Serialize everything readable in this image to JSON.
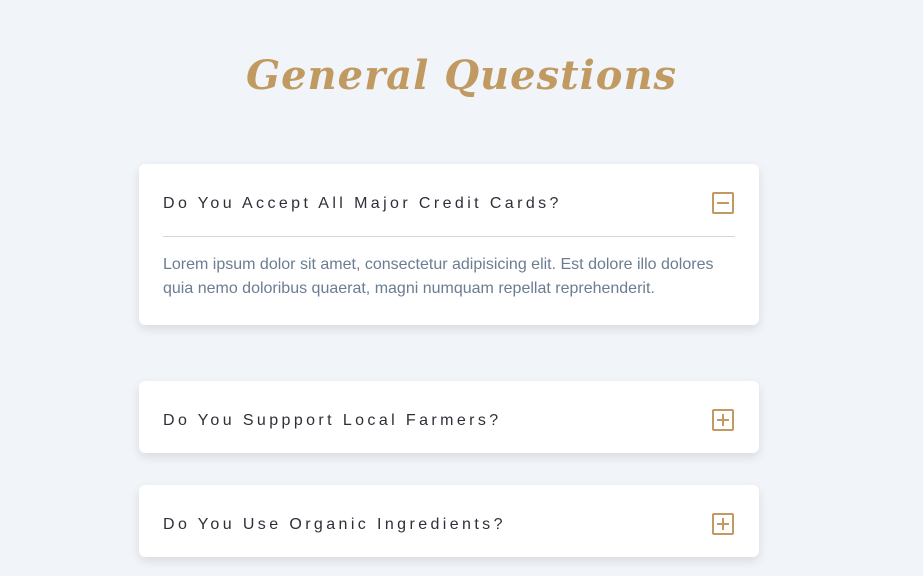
{
  "page": {
    "title": "General Questions"
  },
  "faqs": [
    {
      "question": "Do You Accept All Major Credit Cards?",
      "answer": "Lorem ipsum dolor sit amet, consectetur adipisicing elit. Est dolore illo dolores quia nemo doloribus quaerat, magni numquam repellat reprehenderit.",
      "expanded": true,
      "toggle_icon": "minus-square-icon"
    },
    {
      "question": "Do You Suppport Local Farmers?",
      "expanded": false,
      "toggle_icon": "plus-square-icon"
    },
    {
      "question": "Do You Use Organic Ingredients?",
      "expanded": false,
      "toggle_icon": "plus-square-icon"
    }
  ],
  "colors": {
    "accent": "#c09a61",
    "background": "#f1f4f8",
    "card": "#ffffff",
    "question_text": "#2d3038",
    "answer_text": "#6b7d91"
  }
}
